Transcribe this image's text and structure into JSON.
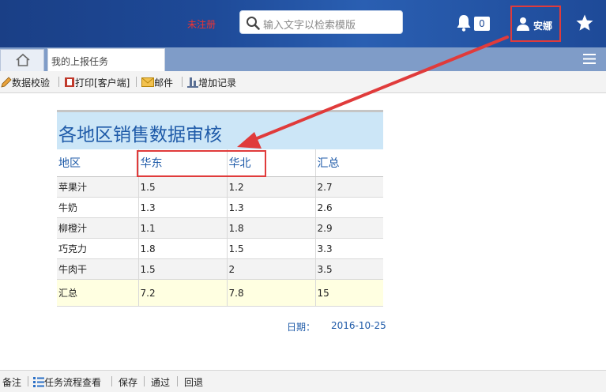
{
  "header": {
    "unregistered": "未注册",
    "search_placeholder": "输入文字以检索模版",
    "notification_count": "0",
    "user_name": "安娜"
  },
  "tabs": {
    "active_tab": "我的上报任务"
  },
  "toolbar": {
    "items": [
      "数据校验",
      "打印[客户端]",
      "邮件",
      "增加记录"
    ]
  },
  "report": {
    "title": "各地区销售数据审核",
    "columns": [
      "地区",
      "华东",
      "华北",
      "汇总"
    ],
    "rows": [
      [
        "苹果汁",
        "1.5",
        "1.2",
        "2.7"
      ],
      [
        "牛奶",
        "1.3",
        "1.3",
        "2.6"
      ],
      [
        "柳橙汁",
        "1.1",
        "1.8",
        "2.9"
      ],
      [
        "巧克力",
        "1.8",
        "1.5",
        "3.3"
      ],
      [
        "牛肉干",
        "1.5",
        "2",
        "3.5"
      ]
    ],
    "total_row": [
      "汇总",
      "7.2",
      "7.8",
      "15"
    ],
    "date_label": "日期：",
    "date_value": "2016-10-25"
  },
  "bottom_bar": {
    "items": [
      "备注",
      "任务流程查看",
      "保存",
      "通过",
      "回退"
    ]
  },
  "colors": {
    "header_blue": "#1e4a98",
    "accent_red": "#e03b3b",
    "title_bg": "#cce6f7",
    "title_text": "#1e5aa8",
    "total_row_bg": "#ffffe1"
  }
}
